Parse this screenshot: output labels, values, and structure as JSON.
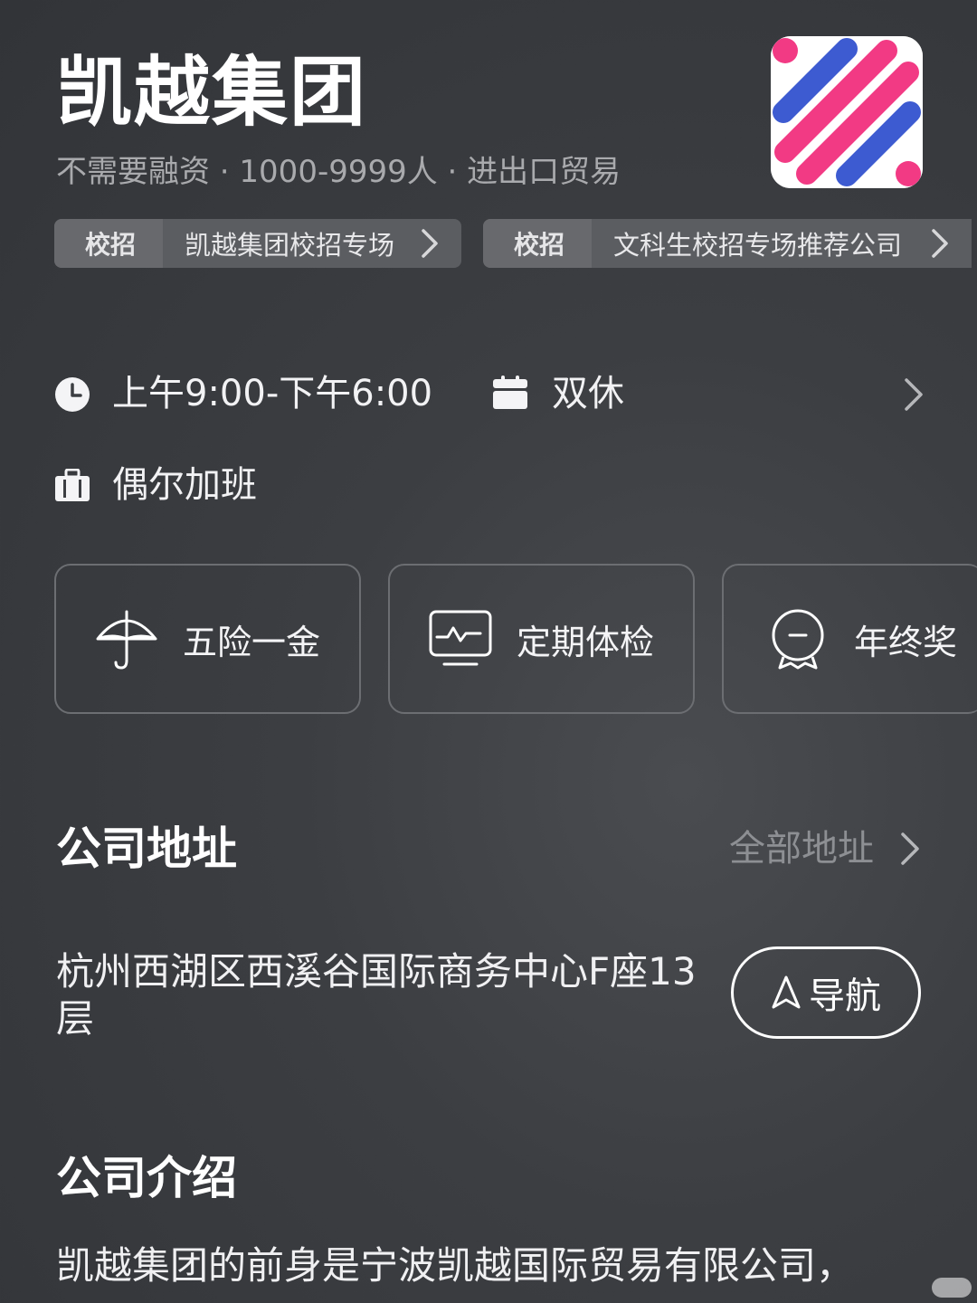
{
  "company": {
    "name": "凯越集团",
    "meta": "不需要融资 · 1000-9999人 · 进出口贸易"
  },
  "campus_pills": [
    {
      "tag": "校招",
      "text": "凯越集团校招专场"
    },
    {
      "tag": "校招",
      "text": "文科生校招专场推荐公司"
    }
  ],
  "work_info": {
    "hours": "上午9:00-下午6:00",
    "weekend": "双休",
    "overtime": "偶尔加班"
  },
  "benefits": [
    {
      "label": "五险一金",
      "icon": "umbrella-icon"
    },
    {
      "label": "定期体检",
      "icon": "monitor-icon"
    },
    {
      "label": "年终奖",
      "icon": "award-icon"
    }
  ],
  "address_section": {
    "title": "公司地址",
    "all_link": "全部地址",
    "address": "杭州西湖区西溪谷国际商务中心F座13层",
    "nav_label": "导航"
  },
  "intro_section": {
    "title": "公司介绍",
    "text": "凯越集团的前身是宁波凯越国际贸易有限公司，"
  },
  "colors": {
    "logo_pink": "#f23a84",
    "logo_blue": "#3d5bd1",
    "background": "#3c3e42"
  }
}
